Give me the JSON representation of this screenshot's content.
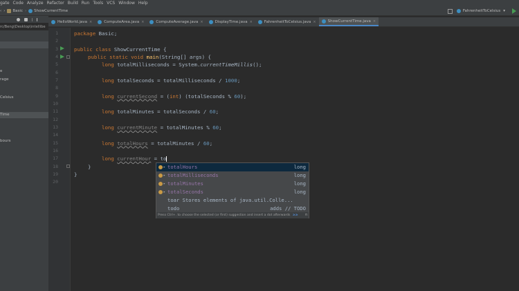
{
  "menu": [
    "gate",
    "Code",
    "Analyze",
    "Refactor",
    "Build",
    "Run",
    "Tools",
    "VCS",
    "Window",
    "Help"
  ],
  "breadcrumb": [
    "Basic",
    "ShowCurrentTime"
  ],
  "run_config": "FahrenheitToCelsius",
  "project_path": "rc/Beng\\Desktop\\intellibe",
  "sidebar_items": [
    "e",
    "rage",
    "Celsius",
    "Time",
    "bours"
  ],
  "tabs": [
    {
      "label": "HelloWorld.java",
      "active": false
    },
    {
      "label": "ComputeArea.java",
      "active": false
    },
    {
      "label": "ComputeAverage.java",
      "active": false
    },
    {
      "label": "DisplayTime.java",
      "active": false
    },
    {
      "label": "FahrenheitToCelsius.java",
      "active": false
    },
    {
      "label": "ShowCurrentTime.java",
      "active": true
    }
  ],
  "line_numbers": [
    "1",
    "2",
    "3",
    "4",
    "5",
    "6",
    "7",
    "8",
    "9",
    "10",
    "11",
    "12",
    "13",
    "14",
    "15",
    "16",
    "17",
    "18",
    "19",
    "20"
  ],
  "code": {
    "l1_kw": "package",
    "l1_rest": " Basic;",
    "l3_kw": "public class",
    "l3_rest": " ShowCurrentTime {",
    "l4_kw": "public static void",
    "l4_name": " main",
    "l4_rest": "(String[] args) {",
    "l5_kw": "long",
    "l5_rest": " totalMilliseconds = System.",
    "l5_call": "currentTimeMillis",
    "l5_end": "();",
    "l7_kw": "long",
    "l7_rest": " totalSeconds = totalMilliseconds / ",
    "l7_num": "1000",
    "l7_end": ";",
    "l9_kw": "long",
    "l9_var": "currentSecond",
    "l9_mid": " = (",
    "l9_kw2": "int",
    "l9_rest": ") (totalSeconds % ",
    "l9_num": "60",
    "l9_end": ");",
    "l11_kw": "long",
    "l11_rest": " totalMinutes = totalSeconds / ",
    "l11_num": "60",
    "l11_end": ";",
    "l13_kw": "long",
    "l13_var": "currentMinute",
    "l13_rest": " = totalMinutes % ",
    "l13_num": "60",
    "l13_end": ";",
    "l15_kw": "long",
    "l15_var": "totalHours",
    "l15_rest": " = totalMinutes / ",
    "l15_num": "60",
    "l15_end": ";",
    "l17_kw": "long",
    "l17_var": "currentHour",
    "l17_rest": " = to",
    "l18": "}",
    "l19": "}"
  },
  "suggestions": [
    {
      "name": "totalHours",
      "type": "long",
      "selected": true,
      "var": true
    },
    {
      "name": "totalMilliseconds",
      "type": "long",
      "selected": false,
      "var": true
    },
    {
      "name": "totalMinutes",
      "type": "long",
      "selected": false,
      "var": true
    },
    {
      "name": "totalSeconds",
      "type": "long",
      "selected": false,
      "var": true
    },
    {
      "name": "toar Stores elements of java.util.Colle...",
      "type": "",
      "selected": false,
      "var": false
    },
    {
      "name": "todo",
      "type": "adds // TODO",
      "selected": false,
      "var": false
    }
  ],
  "popup_hint": "Press Ctrl+. to choose the selected (or first) suggestion and insert a dot afterwards",
  "popup_hint_link": "≥≥",
  "popup_pi": "π"
}
